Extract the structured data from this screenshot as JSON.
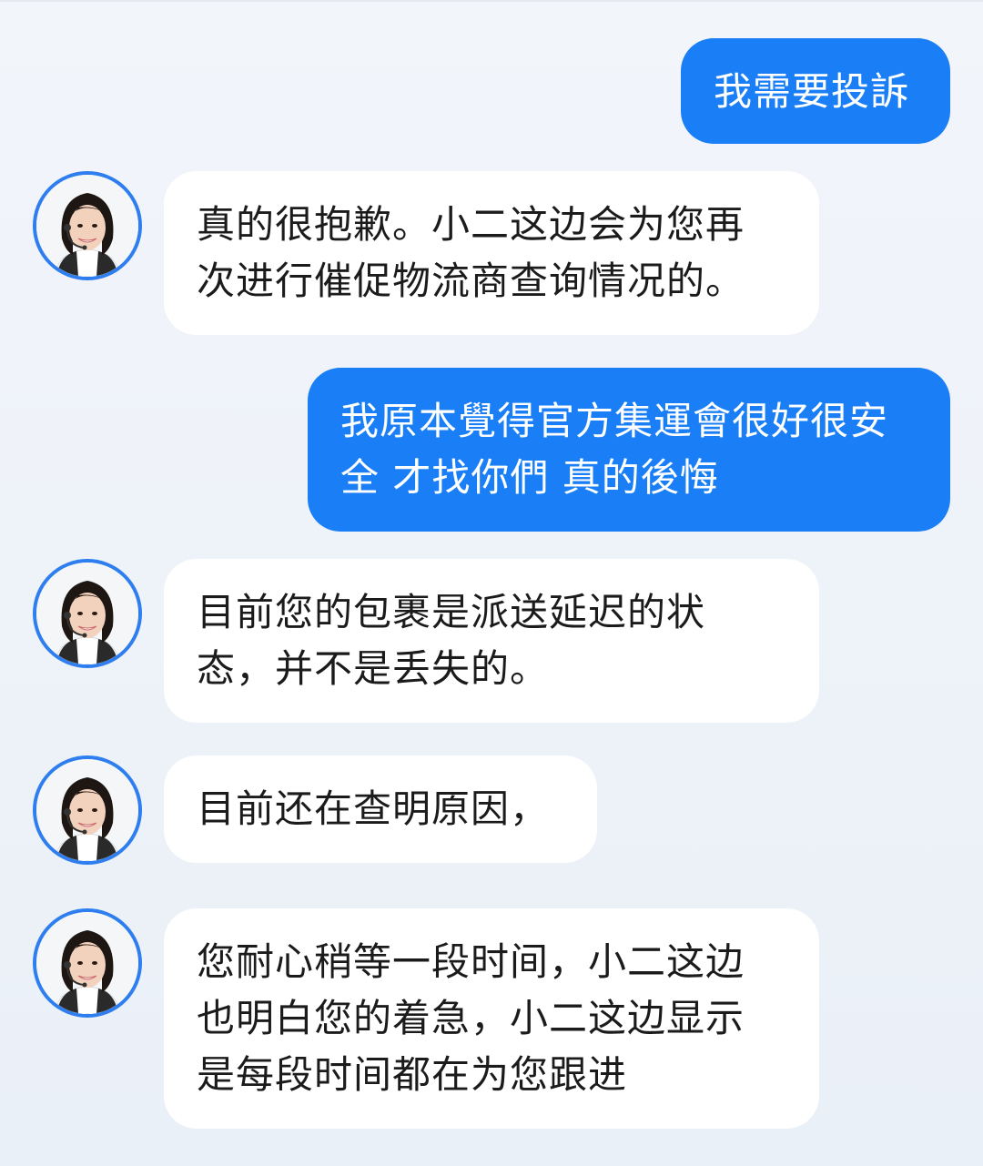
{
  "messages": [
    {
      "role": "user",
      "text": "我需要投訴"
    },
    {
      "role": "agent",
      "avatar_icon": "customer-service-agent-avatar",
      "text": "真的很抱歉。小二这边会为您再\n次进行催促物流商查询情况的。"
    },
    {
      "role": "user",
      "text": "我原本覺得官方集運會很好很安\n全 才找你們 真的後悔"
    },
    {
      "role": "agent",
      "avatar_icon": "customer-service-agent-avatar",
      "text": "目前您的包裹是派送延迟的状\n态，并不是丢失的。"
    },
    {
      "role": "agent",
      "avatar_icon": "customer-service-agent-avatar",
      "text": "目前还在查明原因，"
    },
    {
      "role": "agent",
      "avatar_icon": "customer-service-agent-avatar",
      "text": "您耐心稍等一段时间，小二这边\n也明白您的着急，小二这边显示\n是每段时间都在为您跟进"
    }
  ],
  "colors": {
    "user_bubble": "#1a7ff6",
    "agent_bubble": "#ffffff",
    "avatar_border": "#2f7ef0",
    "background": "#eef2f8"
  }
}
